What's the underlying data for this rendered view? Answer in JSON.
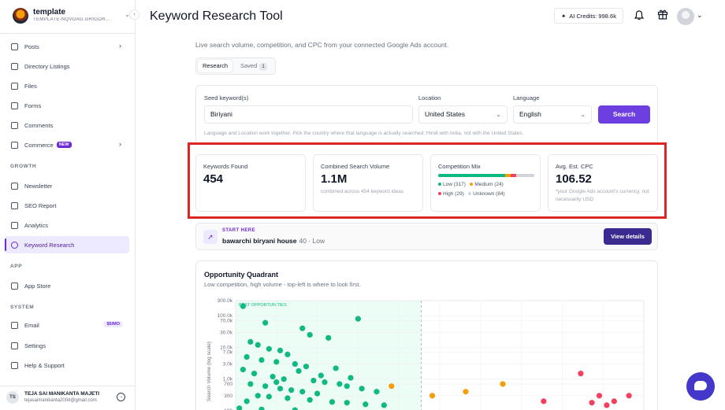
{
  "workspace": {
    "name": "template",
    "subtitle": "TEMPLATE-NQVDAG.GRIGOR..."
  },
  "sidebar": {
    "items": [
      {
        "label": "Posts",
        "icon": "document-icon",
        "chevron": true
      },
      {
        "label": "Directory Listings",
        "icon": "list-icon"
      },
      {
        "label": "Files",
        "icon": "folder-icon"
      },
      {
        "label": "Forms",
        "icon": "clipboard-icon"
      },
      {
        "label": "Comments",
        "icon": "comment-icon"
      },
      {
        "label": "Commerce",
        "icon": "cart-icon",
        "badge": "NEW",
        "chevron": true
      }
    ],
    "growth_label": "GROWTH",
    "growth_items": [
      {
        "label": "Newsletter",
        "icon": "mail-icon"
      },
      {
        "label": "SEO Report",
        "icon": "report-icon"
      },
      {
        "label": "Analytics",
        "icon": "chart-icon"
      },
      {
        "label": "Keyword Research",
        "icon": "search-icon",
        "active": true
      }
    ],
    "app_label": "APP",
    "app_items": [
      {
        "label": "App Store",
        "icon": "store-icon"
      }
    ],
    "system_label": "SYSTEM",
    "system_items": [
      {
        "label": "Email",
        "icon": "mail-icon",
        "badge": "$5/MO"
      },
      {
        "label": "Settings",
        "icon": "gear-icon"
      },
      {
        "label": "Help & Support",
        "icon": "help-icon"
      }
    ]
  },
  "user": {
    "initials": "TS",
    "name": "TEJA SAI MANIKANTA MAJETI",
    "email": "tejasaimanikanta2004@gmail.com"
  },
  "header": {
    "title": "Keyword Research Tool",
    "credits": "AI Credits: 998.6k"
  },
  "page": {
    "subtitle": "Live search volume, competition, and CPC from your connected Google Ads account.",
    "tabs": [
      {
        "label": "Research"
      },
      {
        "label": "Saved",
        "count": "1"
      }
    ]
  },
  "form": {
    "seed_label": "Seed keyword(s)",
    "seed_value": "Biriyani",
    "location_label": "Location",
    "location_value": "United States",
    "language_label": "Language",
    "language_value": "English",
    "search_label": "Search",
    "hint": "Language and Location work together. Pick the country where that language is actually searched: Hindi with India, not with the United States."
  },
  "stats": {
    "keywords": {
      "title": "Keywords Found",
      "value": "454"
    },
    "volume": {
      "title": "Combined Search Volume",
      "value": "1.1M",
      "sub": "combined across 454 keyword ideas"
    },
    "mix": {
      "title": "Competition Mix",
      "low": "Low (317)",
      "medium": "Medium (24)",
      "high": "High (29)",
      "unknown": "Unknown (84)",
      "counts": {
        "low": 317,
        "medium": 24,
        "high": 29,
        "unknown": 84
      },
      "colors": {
        "low": "#10b981",
        "medium": "#f59e0b",
        "high": "#f43f5e",
        "unknown": "#d1d5db"
      }
    },
    "cpc": {
      "title": "Avg. Est. CPC",
      "value": "106.52",
      "sub": "*your Google Ads account's currency, not necessarily USD"
    }
  },
  "start_here": {
    "label": "START HERE",
    "keyword": "bawarchi biryani house",
    "meta": "40 · Low",
    "button": "View details"
  },
  "quadrant": {
    "title": "Opportunity Quadrant",
    "subtitle": "Low competition, high volume - top-left is where to look first.",
    "region_label": "BEST OPPORTUNITIES",
    "ylabel": "Search Volume (log scale)",
    "yticks": [
      "300.0k",
      "100.0k",
      "70.0k",
      "30.0k",
      "10.0k",
      "7.0k",
      "3.0k",
      "1.0k",
      "700",
      "300",
      "100"
    ]
  },
  "chart_data": {
    "type": "scatter",
    "title": "Opportunity Quadrant",
    "ylabel": "Search Volume (log scale)",
    "yscale": "log",
    "yticks": [
      "300.0k",
      "100.0k",
      "70.0k",
      "30.0k",
      "10.0k",
      "7.0k",
      "3.0k",
      "1.0k",
      "700",
      "300",
      "100"
    ],
    "x_range": [
      0,
      100
    ],
    "series": [
      {
        "name": "Low",
        "color": "#10b981",
        "points": [
          [
            2,
            200000
          ],
          [
            8,
            60000
          ],
          [
            18,
            40000
          ],
          [
            20,
            25000
          ],
          [
            25,
            20000
          ],
          [
            33,
            80000
          ],
          [
            4,
            15000
          ],
          [
            6,
            12000
          ],
          [
            9,
            9000
          ],
          [
            12,
            8000
          ],
          [
            14,
            6000
          ],
          [
            3,
            5000
          ],
          [
            7,
            4000
          ],
          [
            11,
            3500
          ],
          [
            16,
            3000
          ],
          [
            19,
            2500
          ],
          [
            2,
            2000
          ],
          [
            5,
            1500
          ],
          [
            10,
            1200
          ],
          [
            13,
            1000
          ],
          [
            21,
            900
          ],
          [
            24,
            800
          ],
          [
            28,
            700
          ],
          [
            30,
            600
          ],
          [
            34,
            500
          ],
          [
            38,
            400
          ],
          [
            4,
            700
          ],
          [
            8,
            600
          ],
          [
            12,
            500
          ],
          [
            15,
            450
          ],
          [
            18,
            400
          ],
          [
            22,
            350
          ],
          [
            6,
            300
          ],
          [
            9,
            280
          ],
          [
            14,
            250
          ],
          [
            20,
            220
          ],
          [
            3,
            200
          ],
          [
            26,
            190
          ],
          [
            30,
            180
          ],
          [
            35,
            160
          ],
          [
            40,
            150
          ],
          [
            1,
            120
          ],
          [
            7,
            110
          ],
          [
            16,
            105
          ],
          [
            11,
            800
          ],
          [
            17,
            1800
          ],
          [
            23,
            1300
          ],
          [
            27,
            2200
          ],
          [
            31,
            1100
          ]
        ]
      },
      {
        "name": "Medium",
        "color": "#f59e0b",
        "points": [
          [
            42,
            600
          ],
          [
            53,
            300
          ],
          [
            62,
            400
          ],
          [
            72,
            700
          ]
        ]
      },
      {
        "name": "High",
        "color": "#f43f5e",
        "points": [
          [
            83,
            200
          ],
          [
            93,
            1500
          ],
          [
            98,
            300
          ],
          [
            102,
            200
          ],
          [
            106,
            300
          ],
          [
            100,
            150
          ],
          [
            96,
            180
          ]
        ]
      }
    ]
  }
}
